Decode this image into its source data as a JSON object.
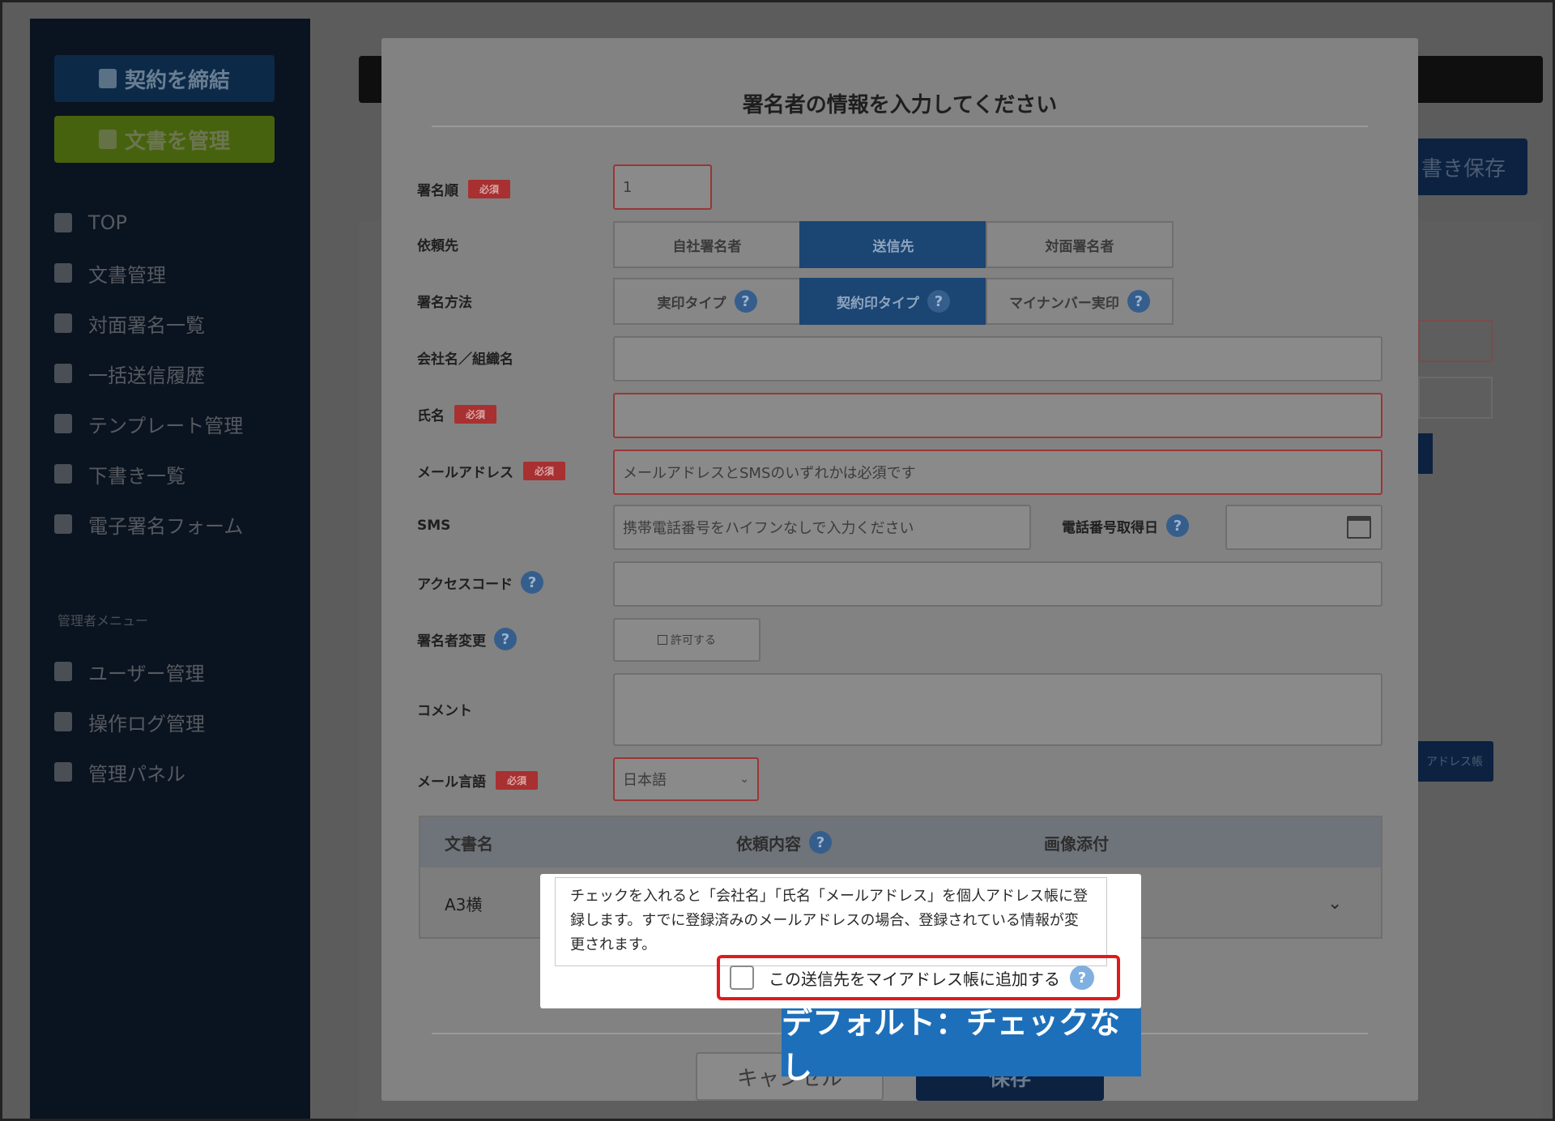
{
  "sidebar": {
    "contract_button": "契約を締結",
    "docs_button": "文書を管理",
    "items": [
      {
        "label": "TOP"
      },
      {
        "label": "文書管理"
      },
      {
        "label": "対面署名一覧"
      },
      {
        "label": "一括送信履歴"
      },
      {
        "label": "テンプレート管理"
      },
      {
        "label": "下書き一覧"
      },
      {
        "label": "電子署名フォーム"
      }
    ],
    "admin_section_label": "管理者メニュー",
    "admin_items": [
      {
        "label": "ユーザー管理"
      },
      {
        "label": "操作ログ管理"
      },
      {
        "label": "管理パネル"
      }
    ]
  },
  "background": {
    "save_draft_button": "書き保存",
    "address_book_button": "アドレス帳"
  },
  "modal": {
    "title": "署名者の情報を入力してください",
    "required_badge": "必須",
    "fields": {
      "signing_order": {
        "label": "署名順",
        "value": "1"
      },
      "request_to": {
        "label": "依頼先",
        "options": [
          "自社署名者",
          "送信先",
          "対面署名者"
        ],
        "selected": "送信先"
      },
      "signing_method": {
        "label": "署名方法",
        "options": [
          "実印タイプ",
          "契約印タイプ",
          "マイナンバー実印"
        ],
        "selected": "契約印タイプ"
      },
      "company": {
        "label": "会社名／組織名",
        "value": ""
      },
      "name": {
        "label": "氏名",
        "value": ""
      },
      "email": {
        "label": "メールアドレス",
        "placeholder": "メールアドレスとSMSのいずれかは必須です"
      },
      "sms": {
        "label": "SMS",
        "placeholder": "携帯電話番号をハイフンなしで入力ください"
      },
      "phone_date": {
        "label": "電話番号取得日",
        "value": ""
      },
      "access_code": {
        "label": "アクセスコード",
        "value": ""
      },
      "signer_change": {
        "label": "署名者変更",
        "checkbox_label": "許可する"
      },
      "comment": {
        "label": "コメント",
        "value": ""
      },
      "mail_language": {
        "label": "メール言語",
        "value": "日本語"
      }
    },
    "docs_table": {
      "headers": [
        "文書名",
        "依頼内容",
        "画像添付"
      ],
      "rows": [
        {
          "name": "A3横"
        }
      ]
    },
    "cancel_button": "キャンセル",
    "save_button": "保存"
  },
  "popup": {
    "description": "チェックを入れると「会社名」「氏名「メールアドレス」を個人アドレス帳に登録します。すでに登録済みのメールアドレスの場合、登録されている情報が変更されます。",
    "checkbox_label": "この送信先をマイアドレス帳に追加する",
    "help_mark": "?"
  },
  "annotation": {
    "badge": "デフォルト：チェックなし"
  },
  "colors": {
    "highlight_border": "#e01b1b",
    "annotation_bg": "#1e6fba",
    "active_segment": "#1b4573",
    "required_badge": "#a83030"
  }
}
